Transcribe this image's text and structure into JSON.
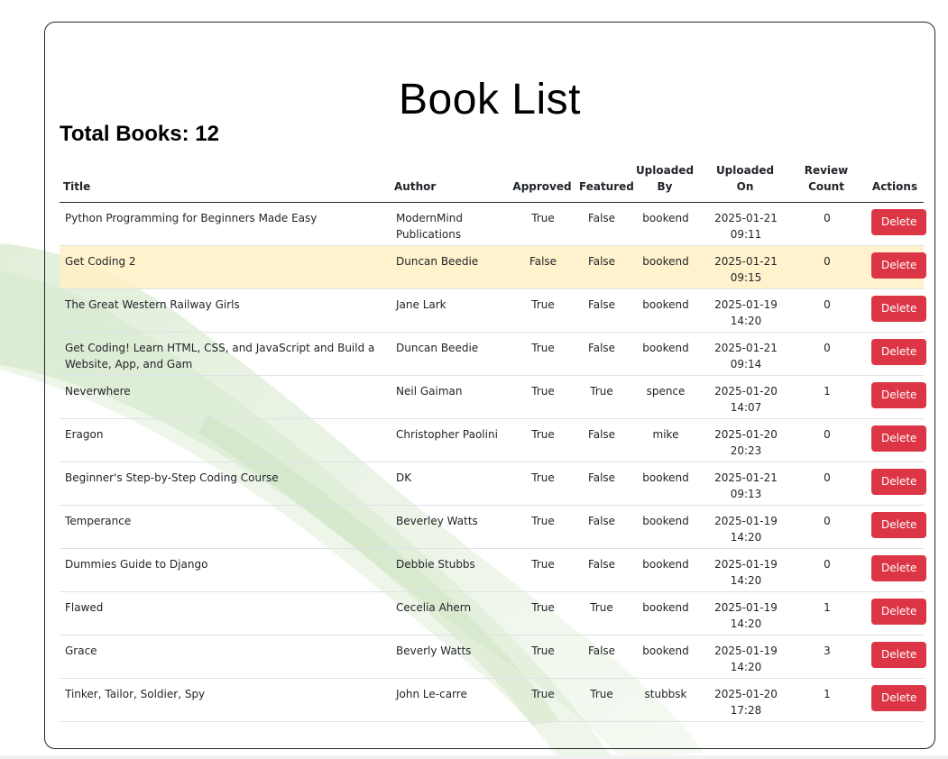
{
  "page": {
    "title": "Book List",
    "total_label": "Total Books: 12"
  },
  "colors": {
    "delete_button": "#dc3545",
    "highlight_row": "#fff3cd",
    "border": "#212529"
  },
  "table": {
    "headers": {
      "title": "Title",
      "author": "Author",
      "approved": "Approved",
      "featured": "Featured",
      "uploaded_by": "Uploaded By",
      "uploaded_on": "Uploaded On",
      "review_count": "Review Count",
      "actions": "Actions"
    },
    "rows": [
      {
        "title": "Python Programming for Beginners Made Easy",
        "author": "ModernMind Publications",
        "approved": "True",
        "featured": "False",
        "uploaded_by": "bookend",
        "uploaded_on": "2025-01-21 09:11",
        "review_count": "0",
        "action": "Delete",
        "highlighted": false
      },
      {
        "title": "Get Coding 2",
        "author": "Duncan Beedie",
        "approved": "False",
        "featured": "False",
        "uploaded_by": "bookend",
        "uploaded_on": "2025-01-21 09:15",
        "review_count": "0",
        "action": "Delete",
        "highlighted": true
      },
      {
        "title": "The Great Western Railway Girls",
        "author": "Jane Lark",
        "approved": "True",
        "featured": "False",
        "uploaded_by": "bookend",
        "uploaded_on": "2025-01-19 14:20",
        "review_count": "0",
        "action": "Delete",
        "highlighted": false
      },
      {
        "title": "Get Coding! Learn HTML, CSS, and JavaScript and Build a Website, App, and Gam",
        "author": "Duncan Beedie",
        "approved": "True",
        "featured": "False",
        "uploaded_by": "bookend",
        "uploaded_on": "2025-01-21 09:14",
        "review_count": "0",
        "action": "Delete",
        "highlighted": false
      },
      {
        "title": "Neverwhere",
        "author": "Neil Gaiman",
        "approved": "True",
        "featured": "True",
        "uploaded_by": "spence",
        "uploaded_on": "2025-01-20 14:07",
        "review_count": "1",
        "action": "Delete",
        "highlighted": false
      },
      {
        "title": "Eragon",
        "author": "Christopher Paolini",
        "approved": "True",
        "featured": "False",
        "uploaded_by": "mike",
        "uploaded_on": "2025-01-20 20:23",
        "review_count": "0",
        "action": "Delete",
        "highlighted": false
      },
      {
        "title": "Beginner's Step-by-Step Coding Course",
        "author": "DK",
        "approved": "True",
        "featured": "False",
        "uploaded_by": "bookend",
        "uploaded_on": "2025-01-21 09:13",
        "review_count": "0",
        "action": "Delete",
        "highlighted": false
      },
      {
        "title": "Temperance",
        "author": "Beverley Watts",
        "approved": "True",
        "featured": "False",
        "uploaded_by": "bookend",
        "uploaded_on": "2025-01-19 14:20",
        "review_count": "0",
        "action": "Delete",
        "highlighted": false
      },
      {
        "title": "Dummies Guide to Django",
        "author": "Debbie Stubbs",
        "approved": "True",
        "featured": "False",
        "uploaded_by": "bookend",
        "uploaded_on": "2025-01-19 14:20",
        "review_count": "0",
        "action": "Delete",
        "highlighted": false
      },
      {
        "title": "Flawed",
        "author": "Cecelia Ahern",
        "approved": "True",
        "featured": "True",
        "uploaded_by": "bookend",
        "uploaded_on": "2025-01-19 14:20",
        "review_count": "1",
        "action": "Delete",
        "highlighted": false
      },
      {
        "title": "Grace",
        "author": "Beverly Watts",
        "approved": "True",
        "featured": "False",
        "uploaded_by": "bookend",
        "uploaded_on": "2025-01-19 14:20",
        "review_count": "3",
        "action": "Delete",
        "highlighted": false
      },
      {
        "title": "Tinker, Tailor, Soldier, Spy",
        "author": "John Le-carre",
        "approved": "True",
        "featured": "True",
        "uploaded_by": "stubbsk",
        "uploaded_on": "2025-01-20 17:28",
        "review_count": "1",
        "action": "Delete",
        "highlighted": false
      }
    ]
  }
}
